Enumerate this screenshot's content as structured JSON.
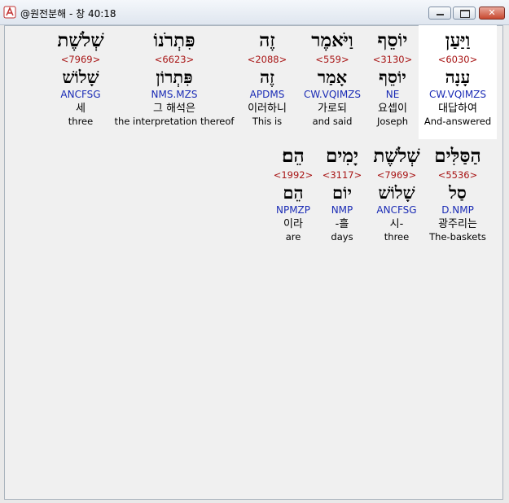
{
  "window": {
    "title": "@원전분해 - 창 40:18",
    "minimize_glyph": "",
    "maximize_glyph": "",
    "close_glyph": "✕"
  },
  "rows": [
    {
      "words": [
        {
          "heb": "וַיַּעַן",
          "strong": "<6030>",
          "root": "עָנָה",
          "parse": "CW.VQIMZS",
          "kor": "대답하여",
          "eng": "And-answered"
        },
        {
          "heb": "יוֹסֵף",
          "strong": "<3130>",
          "root": "יוֹסֵף",
          "parse": "NE",
          "kor": "요셉이",
          "eng": "Joseph"
        },
        {
          "heb": "וַיֹּאמֶר",
          "strong": "<559>",
          "root": "אָמַר",
          "parse": "CW.VQIMZS",
          "kor": "가로되",
          "eng": "and said"
        },
        {
          "heb": "זֶה",
          "strong": "<2088>",
          "root": "זֶה",
          "parse": "APDMS",
          "kor": "이러하니",
          "eng": "This is"
        },
        {
          "heb": "פִּתְרֹנוֹ",
          "strong": "<6623>",
          "root": "פִּתְרוֹן",
          "parse": "NMS.MZS",
          "kor": "그 해석은",
          "eng": "the interpretation thereof"
        },
        {
          "heb": "שְׁלֹשֶׁת",
          "strong": "<7969>",
          "root": "שָׁלוֹשׁ",
          "parse": "ANCFSG",
          "kor": "세",
          "eng": "three"
        }
      ]
    },
    {
      "words": [
        {
          "heb": "הַסַּלִּים",
          "strong": "<5536>",
          "root": "סַל",
          "parse": "D.NMP",
          "kor": "광주리는",
          "eng": "The-baskets"
        },
        {
          "heb": "שְׁלֹשֶׁת",
          "strong": "<7969>",
          "root": "שָׁלוֹשׁ",
          "parse": "ANCFSG",
          "kor": "시-",
          "eng": "three"
        },
        {
          "heb": "יָמִים",
          "strong": "<3117>",
          "root": "יוֹם",
          "parse": "NMP",
          "kor": "-흘",
          "eng": "days"
        },
        {
          "heb": "הֵם׃",
          "strong": "<1992>",
          "root": "הֵם",
          "parse": "NPMZP",
          "kor": "이라",
          "eng": "are"
        }
      ]
    }
  ]
}
